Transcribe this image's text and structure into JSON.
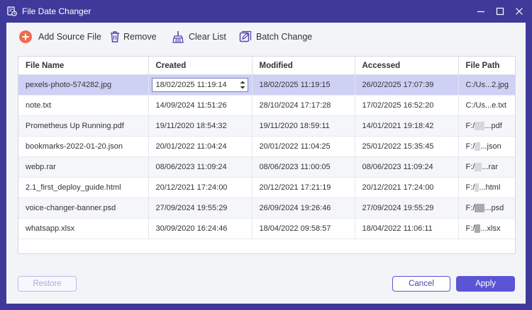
{
  "window": {
    "title": "File Date Changer"
  },
  "toolbar": {
    "add_label": "Add Source File",
    "remove_label": "Remove",
    "clear_label": "Clear List",
    "batch_label": "Batch Change"
  },
  "table": {
    "columns": [
      "File Name",
      "Created",
      "Modified",
      "Accessed",
      "File Path"
    ],
    "rows": [
      {
        "name": "pexels-photo-574282.jpg",
        "created": "18/02/2025 11:19:14",
        "modified": "18/02/2025 11:19:15",
        "accessed": "26/02/2025 17:07:39",
        "path_prefix": "C:/Us...2.jpg",
        "path_suffix": ""
      },
      {
        "name": "note.txt",
        "created": "14/09/2024 11:51:26",
        "modified": "28/10/2024 17:17:28",
        "accessed": "17/02/2025 16:52:20",
        "path_prefix": "C:/Us...e.txt",
        "path_suffix": ""
      },
      {
        "name": "Prometheus Up Running.pdf",
        "created": "19/11/2020 18:54:32",
        "modified": "19/11/2020 18:59:11",
        "accessed": "14/01/2021 19:18:42",
        "path_prefix": "F:/",
        "path_suffix": "...pdf"
      },
      {
        "name": "bookmarks-2022-01-20.json",
        "created": "20/01/2022 11:04:24",
        "modified": "20/01/2022 11:04:25",
        "accessed": "25/01/2022 15:35:45",
        "path_prefix": "F:/",
        "path_suffix": "...json"
      },
      {
        "name": "webp.rar",
        "created": "08/06/2023 11:09:24",
        "modified": "08/06/2023 11:00:05",
        "accessed": "08/06/2023 11:09:24",
        "path_prefix": "F:/",
        "path_suffix": "...rar"
      },
      {
        "name": "2.1_first_deploy_guide.html",
        "created": "20/12/2021 17:24:00",
        "modified": "20/12/2021 17:21:19",
        "accessed": "20/12/2021 17:24:00",
        "path_prefix": "F:/",
        "path_suffix": "...html"
      },
      {
        "name": "voice-changer-banner.psd",
        "created": "27/09/2024 19:55:29",
        "modified": "26/09/2024 19:26:46",
        "accessed": "27/09/2024 19:55:29",
        "path_prefix": "F:/",
        "path_suffix": "...psd"
      },
      {
        "name": "whatsapp.xlsx",
        "created": "30/09/2020 16:24:46",
        "modified": "18/04/2022 09:58:57",
        "accessed": "18/04/2022 11:06:11",
        "path_prefix": "F:/",
        "path_suffix": "...xlsx"
      }
    ]
  },
  "footer": {
    "restore_label": "Restore",
    "cancel_label": "Cancel",
    "apply_label": "Apply"
  },
  "colors": {
    "accent": "#5a54d6",
    "title_bar": "#3f3a9a",
    "add_icon": "#f26b4f",
    "selected_row": "#cfd0f5"
  }
}
